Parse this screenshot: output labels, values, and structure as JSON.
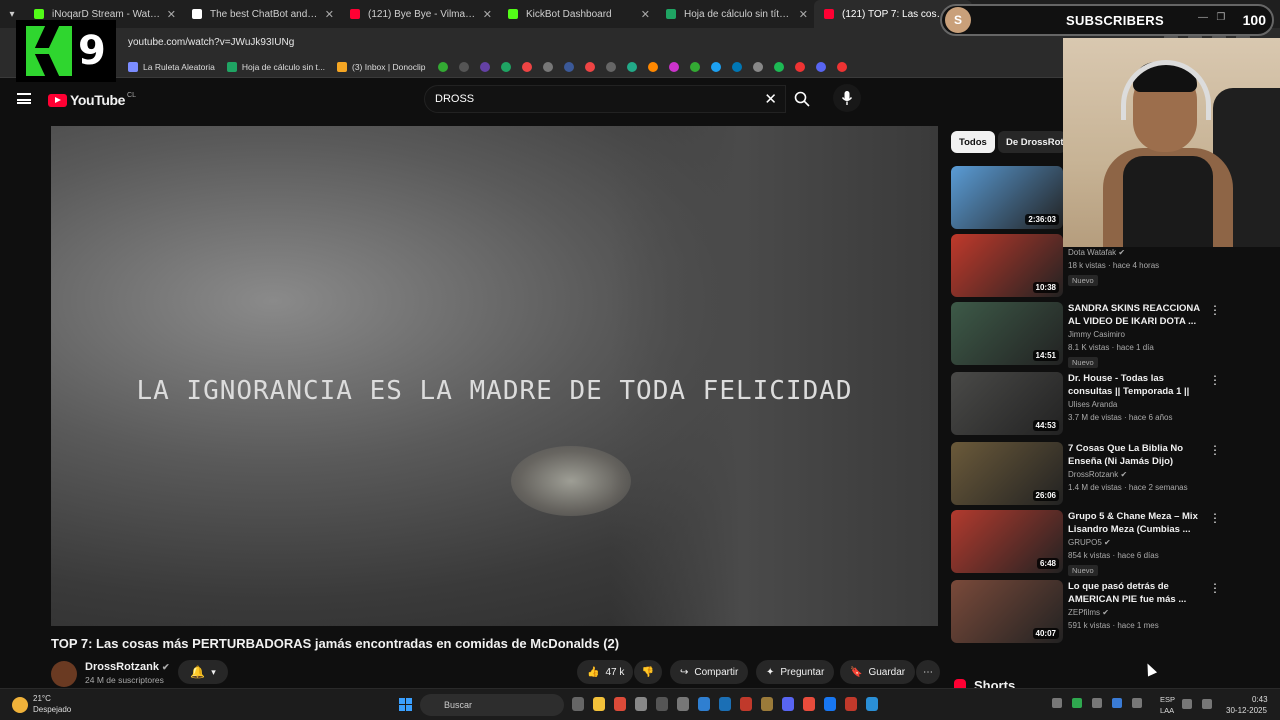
{
  "browser": {
    "tabs": [
      {
        "label": "iNoqarD Stream - Watch Live o",
        "color": "#53fc18"
      },
      {
        "label": "The best ChatBot and Widgets",
        "color": "#ffffff"
      },
      {
        "label": "(121) Bye Bye - Vilma Palma e",
        "color": "#ff0033"
      },
      {
        "label": "KickBot Dashboard",
        "color": "#53fc18"
      },
      {
        "label": "Hoja de cálculo sin título - Hoja",
        "color": "#1fa463"
      },
      {
        "label": "(121) TOP 7: Las cosas más",
        "color": "#ff0033"
      }
    ],
    "url": "youtube.com/watch?v=JWuJk93IUNg",
    "bookmarks": [
      {
        "label": "La Ruleta Aleatoria",
        "color": "#7b8cff"
      },
      {
        "label": "Hoja de cálculo sin t...",
        "color": "#1fa463"
      },
      {
        "label": "(3) Inbox | Donoclip",
        "color": "#f5a623"
      }
    ]
  },
  "overlay": {
    "k9_number": "9",
    "subscribers": {
      "avatar_letter": "S",
      "label": "SUBSCRIBERS",
      "count": "100"
    }
  },
  "youtube": {
    "logo_text": "YouTube",
    "country_code": "CL",
    "search_value": "DROSS",
    "video": {
      "caption": "LA IGNORANCIA ES LA MADRE DE TODA FELICIDAD",
      "title": "TOP 7: Las cosas más PERTURBADORAS jamás encontradas en comidas de McDonalds (2)",
      "channel": "DrossRotzank",
      "verified": "✔",
      "subscribers": "24 M de suscriptores",
      "likes": "47 k",
      "share_label": "Compartir",
      "ask_label": "Preguntar",
      "save_label": "Guardar"
    },
    "chips": [
      "Todos",
      "De DrossRotz"
    ],
    "recommendations": [
      {
        "title": "",
        "channel": "",
        "meta": "",
        "badge": "",
        "duration": "2:36:03",
        "thumb": "#5a9cd6"
      },
      {
        "title": "",
        "channel": "Dota Watafak ✔",
        "meta": "18 k vistas · hace 4 horas",
        "badge": "Nuevo",
        "duration": "10:38",
        "thumb": "#c0392b"
      },
      {
        "title": "SANDRA SKINS REACCIONA AL VIDEO DE IKARI DOTA ...",
        "channel": "Jimmy Casimiro",
        "meta": "8.1 K vistas · hace 1 día",
        "badge": "Nuevo",
        "duration": "14:51",
        "thumb": "#3d5a48"
      },
      {
        "title": "Dr. House - Todas las consultas || Temporada 1 ||",
        "channel": "Ulises Aranda",
        "meta": "3.7 M de vistas · hace 6 años",
        "badge": "",
        "duration": "44:53",
        "thumb": "#4a4a48"
      },
      {
        "title": "7 Cosas Que La Biblia No Enseña (Ni Jamás Dijo)",
        "channel": "DrossRotzank ✔",
        "meta": "1.4 M de vistas · hace 2 semanas",
        "badge": "",
        "duration": "26:06",
        "thumb": "#6b5a3a"
      },
      {
        "title": "Grupo 5 & Chane Meza – Mix Lisandro Meza (Cumbias ...",
        "channel": "GRUPO5 ✔",
        "meta": "854 k vistas · hace 6 días",
        "badge": "Nuevo",
        "duration": "6:48",
        "thumb": "#b23a2e"
      },
      {
        "title": "Lo que pasó detrás de AMERICAN PIE fue más ...",
        "channel": "ZEPfilms ✔",
        "meta": "591 k vistas · hace 1 mes",
        "badge": "",
        "duration": "40:07",
        "thumb": "#7a4a3a"
      }
    ],
    "shorts_label": "Shorts"
  },
  "taskbar": {
    "temperature": "21°C",
    "weather": "Despejado",
    "search_placeholder": "Buscar",
    "lang1": "ESP",
    "lang2": "LAA",
    "time": "0:43",
    "date": "30-12-2025"
  }
}
